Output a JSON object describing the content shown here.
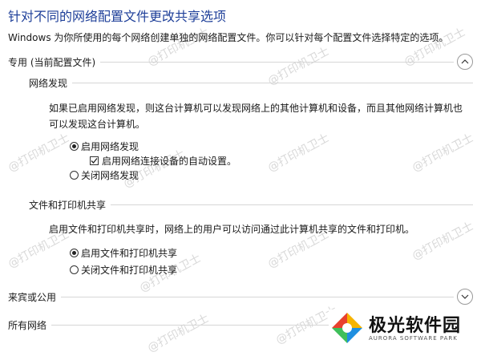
{
  "header": {
    "title": "针对不同的网络配置文件更改共享选项",
    "description": "Windows 为你所使用的每个网络创建单独的网络配置文件。你可以针对每个配置文件选择特定的选项。"
  },
  "private_section": {
    "label": "专用 (当前配置文件)",
    "network_discovery": {
      "heading": "网络发现",
      "description": "如果已启用网络发现，则这台计算机可以发现网络上的其他计算机和设备，而且其他网络计算机也可以发现这台计算机。",
      "option_on": "启用网络发现",
      "auto_setup": "启用网络连接设备的自动设置。",
      "option_off": "关闭网络发现",
      "selected": "on",
      "auto_setup_checked": true
    },
    "file_printer_sharing": {
      "heading": "文件和打印机共享",
      "description": "启用文件和打印机共享时，网络上的用户可以访问通过此计算机共享的文件和打印机。",
      "option_on": "启用文件和打印机共享",
      "option_off": "关闭文件和打印机共享",
      "selected": "on"
    }
  },
  "guest_public_section": {
    "label": "来宾或公用"
  },
  "all_networks_section": {
    "label": "所有网络"
  },
  "watermark": {
    "text": "@打印机卫士"
  },
  "brand": {
    "name": "极光软件园",
    "sub": "AURORA SOFTWARE PARK"
  }
}
